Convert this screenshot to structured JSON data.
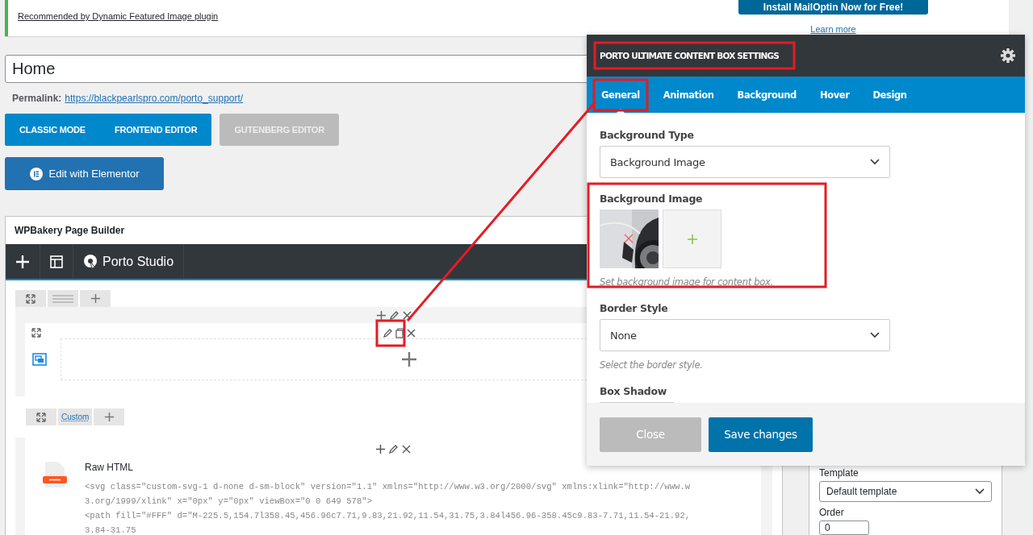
{
  "notice": {
    "link": "Recommended by Dynamic Featured Image plugin",
    "button": "Install MailOptin Now for Free!",
    "learn_more": "Learn more"
  },
  "title_field": {
    "value": "Home"
  },
  "permalink": {
    "label": "Permalink:",
    "url": "https://blackpearlspro.com/porto_support/"
  },
  "editor_buttons": [
    {
      "label": "CLASSIC MODE",
      "disabled": false
    },
    {
      "label": "FRONTEND EDITOR",
      "disabled": false
    },
    {
      "label": "GUTENBERG EDITOR",
      "disabled": true
    }
  ],
  "elementor_button": "Edit with Elementor",
  "builder": {
    "title": "WPBakery Page Builder",
    "toolbar_label": "Porto Studio",
    "row2_layout": "Custom",
    "element": {
      "title": "Raw HTML",
      "code": [
        "<svg class=\"custom-svg-1 d-none d-sm-block\" version=\"1.1\" xmlns=\"http://www.w3.org/2000/svg\" xmlns:xlink=\"http://www.w",
        "3.org/1999/xlink\" x=\"0px\" y=\"0px\" viewBox=\"0 0 649 578\">",
        "<path fill=\"#FFF\" d=\"M-225.5,154.7l358.45,456.96c7.71,9.83,21.92,11.54,31.75,3.84l456.96-358.45c9.83-7.71,11.54-21.92,",
        "3.84-31.75"
      ]
    }
  },
  "sidebar": {
    "template_label": "Template",
    "template_value": "Default template",
    "order_label": "Order",
    "order_value": "0"
  },
  "modal": {
    "title": "PORTO ULTIMATE CONTENT BOX SETTINGS",
    "tabs": [
      {
        "label": "General",
        "selected": true
      },
      {
        "label": "Animation",
        "selected": false
      },
      {
        "label": "Background",
        "selected": false
      },
      {
        "label": "Hover",
        "selected": false
      },
      {
        "label": "Design",
        "selected": false
      }
    ],
    "fields": [
      {
        "kind": "select",
        "label": "Background Type",
        "value": "Background Image"
      },
      {
        "label": "Background Image",
        "help": "Set background image for content box."
      },
      {
        "kind": "select",
        "label": "Border Style",
        "value": "None",
        "help": "Select the border style."
      },
      {
        "kind": "partial",
        "label": "Box Shadow"
      }
    ],
    "buttons": [
      {
        "label": "Close",
        "kind": "secondary"
      },
      {
        "label": "Save changes",
        "kind": "primary"
      }
    ]
  }
}
